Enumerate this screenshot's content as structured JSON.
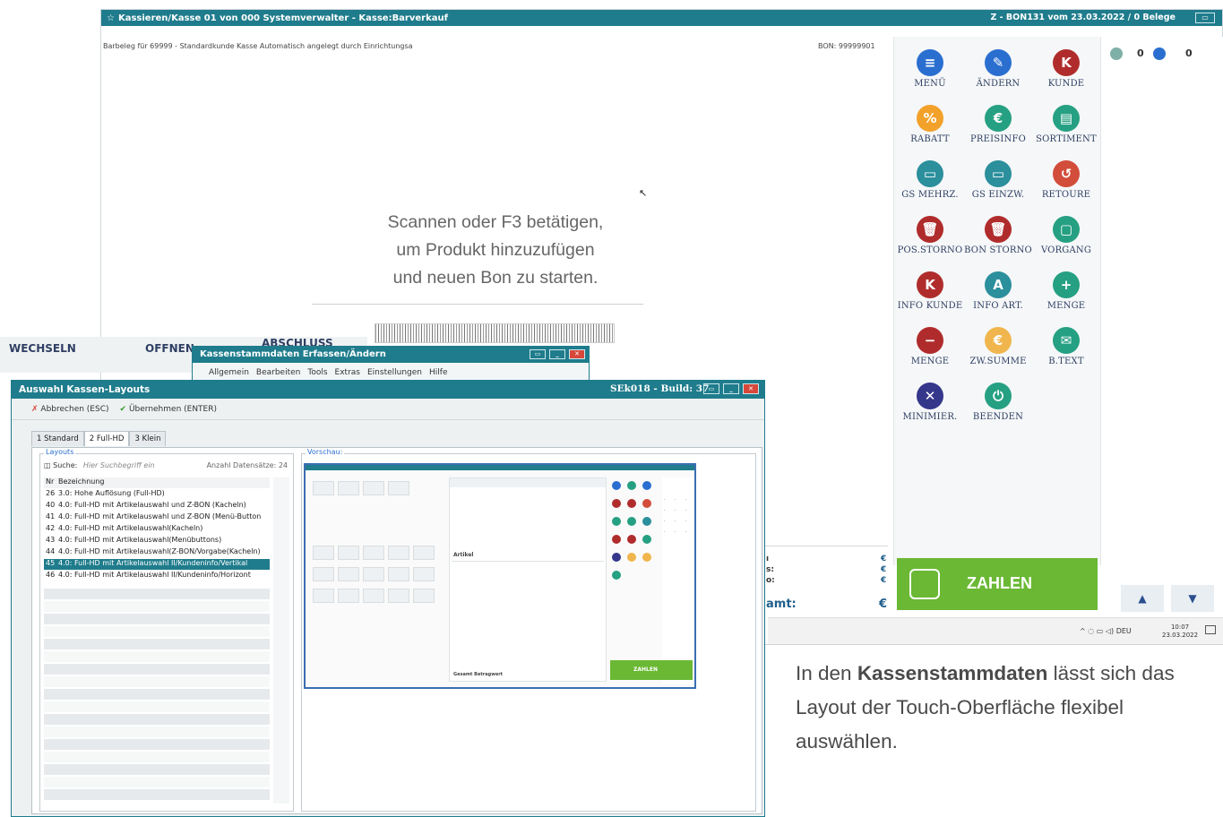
{
  "pos": {
    "title": "Kassieren/Kasse 01 von 000 Systemverwalter - Kasse:Barverkauf",
    "status": "Z - BON131 vom 23.03.2022 / 0 Belege",
    "receipt_info": "Barbeleg für 69999 - Standardkunde Kasse Automatisch angelegt durch Einrichtungsa",
    "bon_no": "BON: 99999901",
    "scan_line1": "Scannen oder F3 betätigen,",
    "scan_line2": "um Produkt hinzuzufügen",
    "scan_line3": "und neuen Bon zu starten.",
    "counter_left": "0",
    "counter_right": "0",
    "total_label": "amt:",
    "currency": "€",
    "row_labels": [
      "ı",
      "s:",
      "o:"
    ],
    "zahlen": "ZAHLEN",
    "functions": [
      {
        "label": "MENÜ",
        "icon": "≡",
        "color": "#2a6fd0"
      },
      {
        "label": "ÄNDERN",
        "icon": "✎",
        "color": "#2a6fd0"
      },
      {
        "label": "KUNDE",
        "icon": "K",
        "color": "#b02c2c"
      },
      {
        "label": "RABATT",
        "icon": "%",
        "color": "#f2a12a"
      },
      {
        "label": "PREISINFO",
        "icon": "€",
        "color": "#26a082"
      },
      {
        "label": "SORTIMENT",
        "icon": "▤",
        "color": "#26a082"
      },
      {
        "label": "GS MEHRZ.",
        "icon": "▭",
        "color": "#2b8f9c"
      },
      {
        "label": "GS EINZW.",
        "icon": "▭",
        "color": "#2b8f9c"
      },
      {
        "label": "RETOURE",
        "icon": "↺",
        "color": "#d24d3a"
      },
      {
        "label": "POS.STORNO",
        "icon": "🗑",
        "color": "#b02c2c"
      },
      {
        "label": "BON STORNO",
        "icon": "🗑",
        "color": "#b02c2c"
      },
      {
        "label": "VORGANG",
        "icon": "▢",
        "color": "#26a082"
      },
      {
        "label": "INFO KUNDE",
        "icon": "K",
        "color": "#b02c2c"
      },
      {
        "label": "INFO ART.",
        "icon": "A",
        "color": "#2b8f9c"
      },
      {
        "label": "MENGE",
        "icon": "+",
        "color": "#26a082"
      },
      {
        "label": "MENGE",
        "icon": "−",
        "color": "#b02c2c"
      },
      {
        "label": "ZW.SUMME",
        "icon": "€",
        "color": "#f0b64d"
      },
      {
        "label": "B.TEXT",
        "icon": "✉",
        "color": "#26a082"
      },
      {
        "label": "MINIMIER.",
        "icon": "✕",
        "color": "#34378a"
      },
      {
        "label": "BEENDEN",
        "icon": "⏻",
        "color": "#26a082"
      }
    ],
    "tray_lang": "DEU",
    "clock_time": "10:07",
    "clock_date": "23.03.2022"
  },
  "bgwin": {
    "wechseln": "WECHSELN",
    "offnen": "OFFNEN",
    "abschluss": "ABSCHLUSS"
  },
  "ksd": {
    "title": "Kassenstammdaten Erfassen/Ändern",
    "menu": [
      "Allgemein",
      "Bearbeiten",
      "Tools",
      "Extras",
      "Einstellungen",
      "Hilfe"
    ]
  },
  "ak": {
    "title": "Auswahl Kassen-Layouts",
    "build": "SEk018 - Build: 37",
    "cancel": "Abbrechen (ESC)",
    "apply": "Übernehmen (ENTER)",
    "tabs": [
      "1 Standard",
      "2 Full-HD",
      "3 Klein"
    ],
    "layouts_legend": "Layouts",
    "search_label": "Suche:",
    "search_placeholder": "Hier Suchbegriff ein",
    "count_label": "Anzahl Datensätze: 24",
    "col_nr": "Nr",
    "col_name": "Bezeichnung",
    "rows": [
      {
        "nr": "26",
        "name": "3.0: Hohe Auflösung (Full-HD)"
      },
      {
        "nr": "40",
        "name": "4.0: Full-HD mit Artikelauswahl und Z-BON (Kacheln)"
      },
      {
        "nr": "41",
        "name": "4.0: Full-HD mit Artikelauswahl und Z-BON (Menü-Button"
      },
      {
        "nr": "42",
        "name": "4.0: Full-HD mit Artikelauswahl(Kacheln)"
      },
      {
        "nr": "43",
        "name": "4.0: Full-HD mit Artikelauswahl(Menübuttons)"
      },
      {
        "nr": "44",
        "name": "4.0: Full-HD mit Artikelauswahl(Z-BON/Vorgabe(Kacheln)"
      },
      {
        "nr": "45",
        "name": "4.0: Full-HD mit Artikelauswahl II/Kundeninfo/Vertikal"
      },
      {
        "nr": "46",
        "name": "4.0: Full-HD mit Artikelauswahl II/Kundeninfo/Horizont"
      }
    ],
    "preview_legend": "Vorschau:",
    "mini_artikel": "Artikel",
    "mini_zahlen": "ZAHLEN",
    "mini_gesamt": "Gesamt Betragwert"
  },
  "caption": {
    "pre": "In den ",
    "bold": "Kassenstammdaten",
    "post": " lässt sich das Layout der Touch-Oberfläche flexibel auswählen."
  }
}
